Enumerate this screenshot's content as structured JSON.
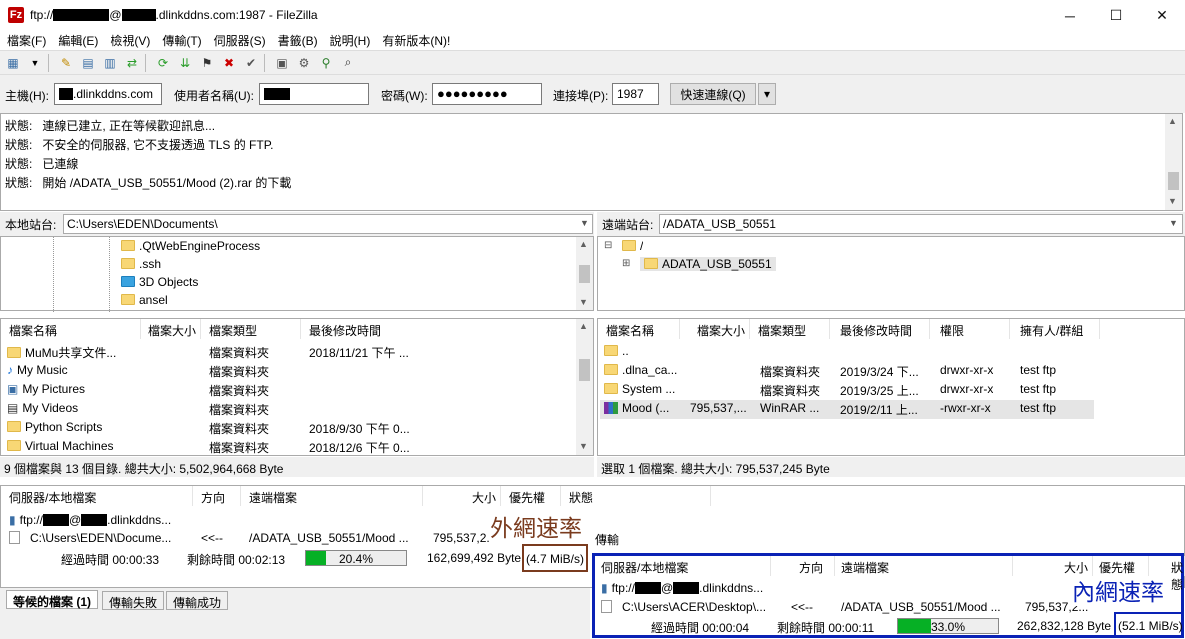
{
  "window": {
    "title_prefix": "ftp://",
    "title_mid": "@",
    "title_suffix": ".dlinkddns.com:1987 - FileZilla",
    "app_icon": "Fz",
    "min_glyph": "─",
    "max_glyph": "☐",
    "close_glyph": "✕"
  },
  "menu": [
    "檔案(F)",
    "編輯(E)",
    "檢視(V)",
    "傳輸(T)",
    "伺服器(S)",
    "書籤(B)",
    "說明(H)",
    "有新版本(N)!"
  ],
  "toolbar_icons": [
    "site-manager-icon",
    "dropdown-arrow-icon",
    "message-log-icon",
    "local-tree-icon",
    "remote-tree-icon",
    "transfer-queue-icon",
    "refresh-icon",
    "process-queue-icon",
    "cancel-icon",
    "disconnect-icon",
    "reconnect-icon",
    "directory-listing-filter-icon",
    "toggle-filter-icon",
    "sync-browse-icon",
    "search-icon"
  ],
  "quickconnect": {
    "host_label": "主機(H):",
    "host_value": ".dlinkddns.com",
    "user_label": "使用者名稱(U):",
    "pass_label": "密碼(W):",
    "pass_value": "●●●●●●●●●",
    "port_label": "連接埠(P):",
    "port_value": "1987",
    "connect_button": "快速連線(Q)",
    "dropdown_glyph": "▾"
  },
  "log": [
    {
      "label": "狀態:",
      "text": "連線已建立, 正在等候歡迎訊息..."
    },
    {
      "label": "狀態:",
      "text": "不安全的伺服器, 它不支援透過 TLS 的 FTP."
    },
    {
      "label": "狀態:",
      "text": "已連線"
    },
    {
      "label": "狀態:",
      "text": "開始 /ADATA_USB_50551/Mood (2).rar 的下載"
    }
  ],
  "local": {
    "site_label": "本地站台:",
    "site_path": "C:\\Users\\EDEN\\Documents\\",
    "tree": [
      ".QtWebEngineProcess",
      ".ssh",
      "3D Objects",
      "ansel"
    ],
    "columns": [
      "檔案名稱",
      "檔案大小",
      "檔案類型",
      "最後修改時間"
    ],
    "files": [
      {
        "name": "MuMu共享文件...",
        "size": "",
        "type": "檔案資料夾",
        "modified": "2018/11/21 下午 ..."
      },
      {
        "name": "My Music",
        "size": "",
        "type": "檔案資料夾",
        "modified": ""
      },
      {
        "name": "My Pictures",
        "size": "",
        "type": "檔案資料夾",
        "modified": ""
      },
      {
        "name": "My Videos",
        "size": "",
        "type": "檔案資料夾",
        "modified": ""
      },
      {
        "name": "Python Scripts",
        "size": "",
        "type": "檔案資料夾",
        "modified": "2018/9/30 下午 0..."
      },
      {
        "name": "Virtual Machines",
        "size": "",
        "type": "檔案資料夾",
        "modified": "2018/12/6 下午 0..."
      }
    ],
    "status": "9 個檔案與 13 個目錄. 總共大小: 5,502,964,668 Byte"
  },
  "remote": {
    "site_label": "遠端站台:",
    "site_path": "/ADATA_USB_50551",
    "tree_root": "/",
    "tree_child": "ADATA_USB_50551",
    "columns": [
      "檔案名稱",
      "檔案大小",
      "檔案類型",
      "最後修改時間",
      "權限",
      "擁有人/群組"
    ],
    "files": [
      {
        "name": "..",
        "size": "",
        "type": "",
        "modified": "",
        "perm": "",
        "owner": ""
      },
      {
        "name": ".dlna_ca...",
        "size": "",
        "type": "檔案資料夾",
        "modified": "2019/3/24 下...",
        "perm": "drwxr-xr-x",
        "owner": "test ftp"
      },
      {
        "name": "System ...",
        "size": "",
        "type": "檔案資料夾",
        "modified": "2019/3/25 上...",
        "perm": "drwxr-xr-x",
        "owner": "test ftp"
      },
      {
        "name": "Mood (...",
        "size": "795,537,...",
        "type": "WinRAR ...",
        "modified": "2019/2/11 上...",
        "perm": "-rwxr-xr-x",
        "owner": "test ftp"
      }
    ],
    "status": "選取 1 個檔案. 總共大小: 795,537,245 Byte"
  },
  "queue": {
    "columns": [
      "伺服器/本地檔案",
      "方向",
      "遠端檔案",
      "大小",
      "優先權",
      "狀態"
    ],
    "server_prefix": "ftp://",
    "server_mid": "@",
    "server_suffix": ".dlinkddns...",
    "local_file": "C:\\Users\\EDEN\\Docume...",
    "direction": "<<--",
    "remote_file": "/ADATA_USB_50551/Mood ...",
    "size": "795,537,2...",
    "state": "傳輸",
    "elapsed": "經過時間 00:00:33",
    "remaining": "剩餘時間 00:02:13",
    "progress_label": "20.4%",
    "progress": 20.4,
    "bytes": "162,699,492 Byte",
    "speed": "(4.7 MiB/s)"
  },
  "annotation_outer": {
    "label": "外網速率",
    "color": "#7a3b1e"
  },
  "inset": {
    "columns": [
      "伺服器/本地檔案",
      "方向",
      "遠端檔案",
      "大小",
      "優先權",
      "狀態"
    ],
    "server_prefix": "ftp://",
    "server_mid": "@",
    "server_suffix": ".dlinkddns...",
    "local_file": "C:\\Users\\ACER\\Desktop\\...",
    "direction": "<<--",
    "remote_file": "/ADATA_USB_50551/Mood ...",
    "size": "795,537,2...",
    "elapsed": "經過時間 00:00:04",
    "remaining": "剩餘時間 00:00:11",
    "progress_label": "33.0%",
    "progress": 33.0,
    "bytes": "262,832,128 Byte",
    "speed": "(52.1 MiB/s)",
    "label": "內網速率",
    "color": "#0a22b5"
  },
  "tabs": [
    "等候的檔案 (1)",
    "傳輸失敗",
    "傳輸成功"
  ]
}
